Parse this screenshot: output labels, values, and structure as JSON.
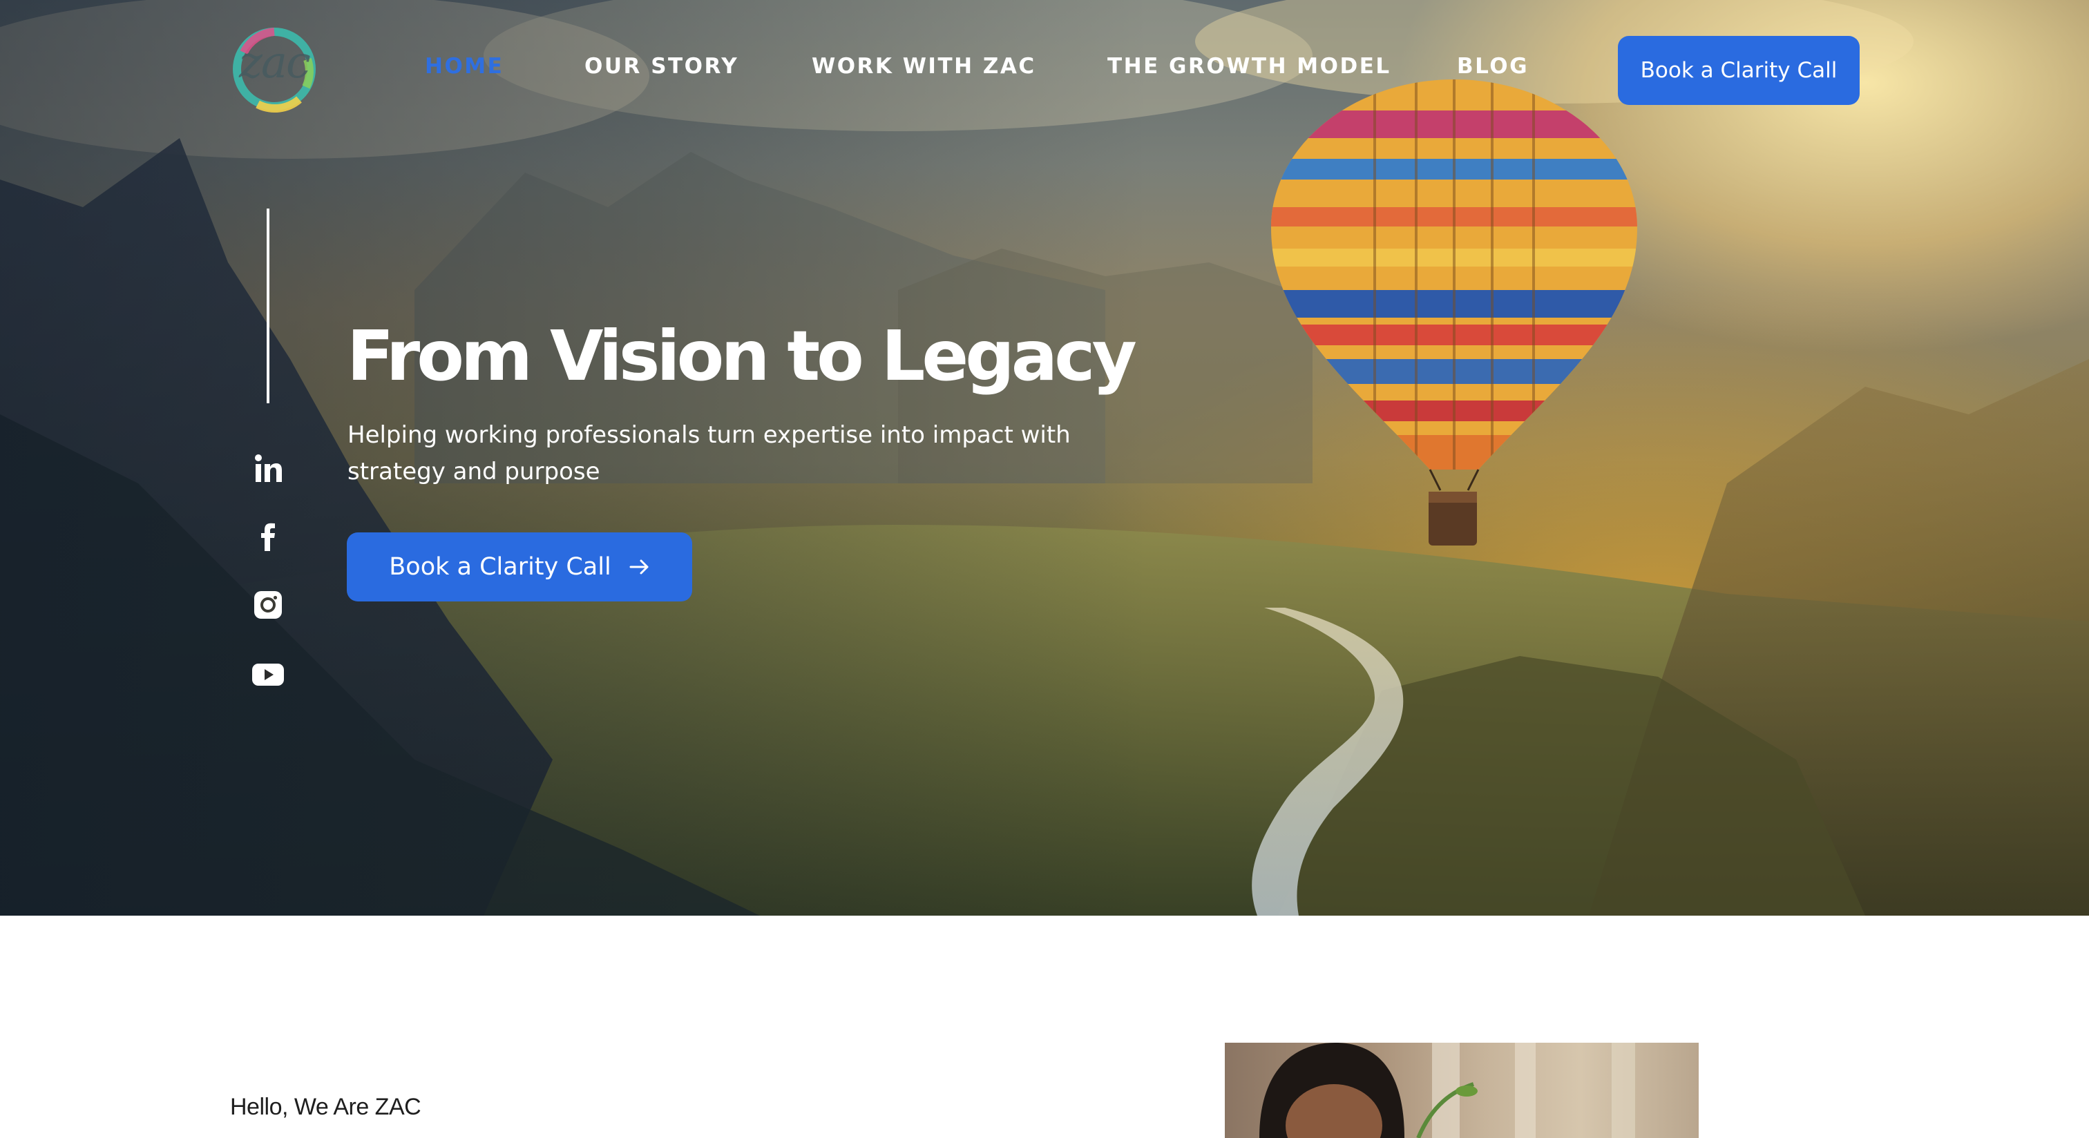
{
  "brand": {
    "logo_text": "zac"
  },
  "nav": {
    "items": [
      {
        "label": "HOME",
        "active": true
      },
      {
        "label": "OUR STORY",
        "active": false
      },
      {
        "label": "WORK WITH ZAC",
        "active": false
      },
      {
        "label": "THE GROWTH MODEL",
        "active": false
      },
      {
        "label": "BLOG",
        "active": false
      }
    ],
    "cta_label": "Book a Clarity Call"
  },
  "social": [
    "linkedin-icon",
    "facebook-icon",
    "instagram-icon",
    "youtube-icon"
  ],
  "hero": {
    "headline": "From Vision to Legacy",
    "subtitle": "Helping working professionals turn expertise into impact with strategy and purpose",
    "cta_label": "Book a Clarity Call"
  },
  "intro": {
    "greeting": "Hello, We Are ZAC"
  },
  "colors": {
    "accent": "#2a6be0",
    "active_nav": "#2f6fe0",
    "text_on_hero": "#ffffff"
  }
}
